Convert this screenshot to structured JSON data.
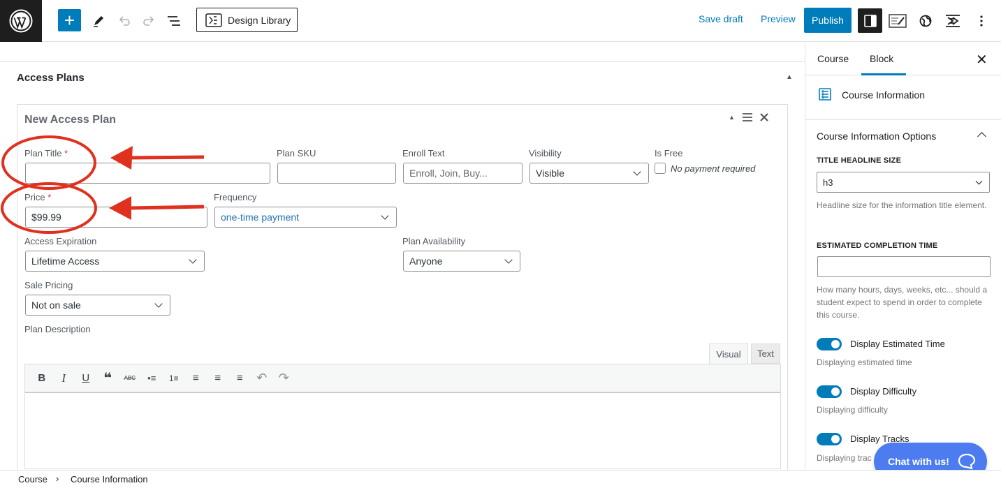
{
  "toolbar": {
    "design_library_label": "Design Library",
    "save_draft_label": "Save draft",
    "preview_label": "Preview",
    "publish_label": "Publish",
    "add_block_symbol": "+",
    "icons": [
      "wordpress-logo-icon",
      "add-block-icon",
      "edit-tool-icon",
      "undo-icon",
      "redo-icon",
      "document-overview-icon",
      "design-library-icon",
      "settings-icon",
      "editor-icon",
      "globe-icon",
      "kadence-icon",
      "more-options-icon"
    ]
  },
  "main": {
    "section_title": "Access Plans",
    "plan": {
      "title": "New Access Plan",
      "fields": {
        "plan_title_label": "Plan Title",
        "required_mark": "*",
        "plan_title_value": "",
        "plan_sku_label": "Plan SKU",
        "enroll_text_label": "Enroll Text",
        "enroll_text_placeholder": "Enroll, Join, Buy...",
        "visibility_label": "Visibility",
        "visibility_value": "Visible",
        "is_free_label": "Is Free",
        "is_free_checkbox_label": "No payment required",
        "is_free_checked": false,
        "price_label": "Price",
        "price_value": "$99.99",
        "frequency_label": "Frequency",
        "frequency_value": "one-time payment",
        "access_expiration_label": "Access Expiration",
        "access_expiration_value": "Lifetime Access",
        "plan_availability_label": "Plan Availability",
        "plan_availability_value": "Anyone",
        "sale_pricing_label": "Sale Pricing",
        "sale_pricing_value": "Not on sale",
        "plan_description_label": "Plan Description"
      },
      "editor": {
        "tab_visual": "Visual",
        "tab_text": "Text",
        "tools": [
          "bold-icon",
          "italic-icon",
          "underline-icon",
          "blockquote-icon",
          "strikethrough-icon",
          "bullet-list-icon",
          "numbered-list-icon",
          "align-left-icon",
          "align-center-icon",
          "align-right-icon",
          "undo-icon",
          "redo-icon"
        ],
        "tool_glyphs": [
          "B",
          "I",
          "U",
          "❝",
          "ABC",
          "•≡",
          "1≡",
          "≡",
          "≡",
          "≡",
          "↶",
          "↷"
        ]
      }
    },
    "annotation_color": "#e0301e"
  },
  "sidebar": {
    "tab_course": "Course",
    "tab_block": "Block",
    "close_symbol": "✕",
    "block_name": "Course Information",
    "options_title": "Course Information Options",
    "title_headline_size_label": "TITLE HEADLINE SIZE",
    "title_headline_size_value": "h3",
    "title_headline_help": "Headline size for the information title element.",
    "estimated_time_label": "ESTIMATED COMPLETION TIME",
    "estimated_time_value": "",
    "estimated_time_help": "How many hours, days, weeks, etc... should a student expect to spend in order to complete this course.",
    "toggles": [
      {
        "label": "Display Estimated Time",
        "help": "Displaying estimated time",
        "on": true
      },
      {
        "label": "Display Difficulty",
        "help": "Displaying difficulty",
        "on": true
      },
      {
        "label": "Display Tracks",
        "help": "Displaying trac",
        "on": true
      }
    ],
    "accent_color": "#007cba"
  },
  "chat": {
    "label": "Chat with us!"
  },
  "breadcrumb": {
    "items": [
      "Course",
      "Course Information"
    ],
    "separator": "›"
  }
}
